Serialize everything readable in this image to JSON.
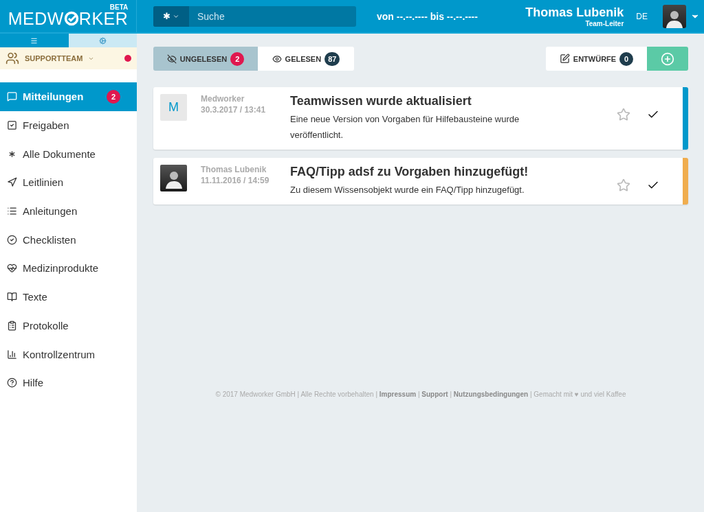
{
  "logo": {
    "before": "MEDW",
    "after": "RKER",
    "badge": "BETA"
  },
  "search": {
    "scope": "✱",
    "placeholder": "Suche"
  },
  "date_range": "von --.--.---- bis --.--.----",
  "user": {
    "name": "Thomas Lubenik",
    "role": "Team-Leiter",
    "language": "DE"
  },
  "sidebar": {
    "tabs": [
      {
        "selected": false
      },
      {
        "selected": true
      }
    ],
    "team": {
      "name": "SUPPORTTEAM",
      "color": "#e0174f"
    },
    "items": [
      {
        "label": "Mitteilungen",
        "selected": true,
        "badge": "2"
      },
      {
        "label": "Freigaben",
        "selected": false
      },
      {
        "label": "Alle Dokumente",
        "selected": false
      },
      {
        "label": "Leitlinien",
        "selected": false
      },
      {
        "label": "Anleitungen",
        "selected": false
      },
      {
        "label": "Checklisten",
        "selected": false
      },
      {
        "label": "Medizinprodukte",
        "selected": false
      },
      {
        "label": "Texte",
        "selected": false
      },
      {
        "label": "Protokolle",
        "selected": false
      },
      {
        "label": "Kontrollzentrum",
        "selected": false
      },
      {
        "label": "Hilfe",
        "selected": false
      }
    ]
  },
  "filter_tabs": [
    {
      "label": "UNGELESEN",
      "count": "2",
      "selected": true
    },
    {
      "label": "GELESEN",
      "count": "87",
      "selected": false
    }
  ],
  "drafts": {
    "label": "ENTWÜRFE",
    "count": "0"
  },
  "messages": [
    {
      "avatar": {
        "kind": "letter",
        "text": "M"
      },
      "sender": "Medworker",
      "time": "30.3.2017 / 13:41",
      "title": "Teamwissen wurde aktualisiert",
      "body": "Eine neue Version von Vorgaben für Hilfebausteine wurde veröffentlicht.",
      "starred": false,
      "color": "#0098cb"
    },
    {
      "avatar": {
        "kind": "photo"
      },
      "sender": "Thomas Lubenik",
      "time": "11.11.2016 / 14:59",
      "title": "FAQ/Tipp adsf zu Vorgaben hinzugefügt!",
      "body": "Zu diesem Wissensobjekt wurde ein FAQ/Tipp hinzugefügt.",
      "starred": false,
      "color": "#f0ad4e"
    }
  ],
  "footer": [
    {
      "kind": "text",
      "text": "© 2017 Medworker GmbH | Alle Rechte vorbehalten |"
    },
    {
      "kind": "link",
      "text": "Impressum"
    },
    {
      "kind": "text",
      "text": "|"
    },
    {
      "kind": "link",
      "text": "Support"
    },
    {
      "kind": "text",
      "text": "|"
    },
    {
      "kind": "link",
      "text": "Nutzungsbedingungen"
    },
    {
      "kind": "text",
      "text": "| Gemacht mit ♥ und viel Kaffee"
    }
  ]
}
